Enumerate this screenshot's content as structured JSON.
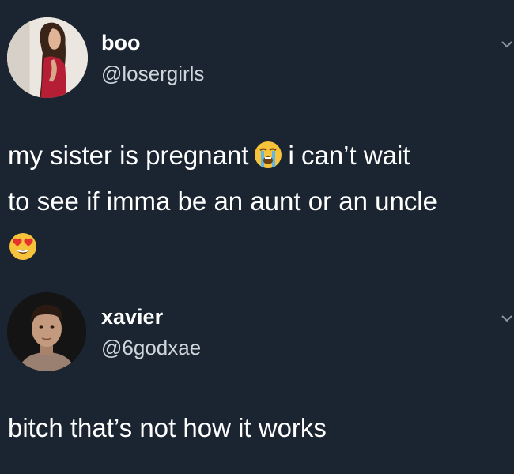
{
  "tweets": [
    {
      "display_name": "boo",
      "handle": "@losergirls",
      "text": {
        "line1_before_emoji": "my sister is pregnant",
        "line1_emoji": "loudly-crying-face",
        "line1_after_emoji": "i can’t wait",
        "line2": "to see if imma be an aunt or an uncle",
        "line3_emoji": "heart-eyes-face"
      }
    },
    {
      "display_name": "xavier",
      "handle": "@6godxae",
      "text": {
        "line1": "bitch that’s not how it works"
      }
    }
  ],
  "icons": {
    "menu": "chevron-down-icon"
  },
  "colors": {
    "background": "#1b2531",
    "text_primary": "#ffffff",
    "text_secondary": "#cfd5db",
    "emoji_yellow": "#f6c33a",
    "emoji_tears": "#5db6ea",
    "emoji_heart": "#e5322d"
  }
}
